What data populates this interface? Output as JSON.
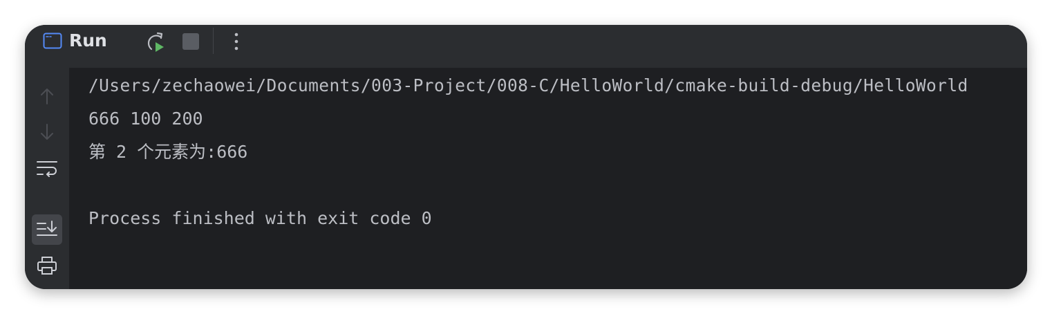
{
  "toolbar": {
    "title": "Run",
    "icons": {
      "run_window": "run-console-icon",
      "rerun": "rerun-icon",
      "stop": "stop-icon",
      "more": "more-vertical-icon"
    }
  },
  "gutter": {
    "icons": [
      "up-arrow-icon",
      "down-arrow-icon",
      "soft-wrap-icon",
      "scroll-to-end-icon",
      "print-icon",
      "trash-icon"
    ],
    "active": "scroll-to-end-icon"
  },
  "console": {
    "lines": [
      "/Users/zechaowei/Documents/003-Project/008-C/HelloWorld/cmake-build-debug/HelloWorld",
      "666 100 200",
      "第 2 个元素为:666",
      "",
      "Process finished with exit code 0"
    ]
  },
  "colors": {
    "window_bg": "#2b2d30",
    "console_bg": "#1e1f22",
    "text": "#bcbec4",
    "title": "#dfe1e5",
    "accent_blue": "#548af7",
    "accent_green": "#5fb865",
    "icon_gray": "#6f737a"
  }
}
